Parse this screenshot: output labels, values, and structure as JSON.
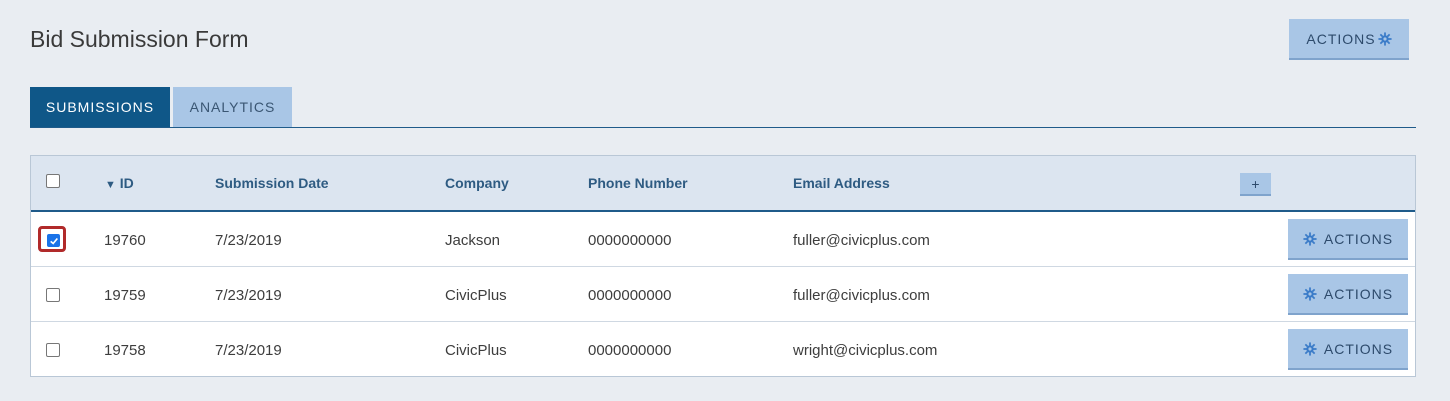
{
  "page": {
    "title": "Bid Submission Form",
    "actions_label": "ACTIONS"
  },
  "tabs": [
    {
      "label": "SUBMISSIONS",
      "active": true
    },
    {
      "label": "ANALYTICS",
      "active": false
    }
  ],
  "table": {
    "sort_indicator": "▼",
    "columns": {
      "id": "ID",
      "submission_date": "Submission Date",
      "company": "Company",
      "phone": "Phone Number",
      "email": "Email Address"
    },
    "add_column_label": "+",
    "row_actions_label": "ACTIONS",
    "rows": [
      {
        "id": "19760",
        "date": "7/23/2019",
        "company": "Jackson",
        "phone": "0000000000",
        "email": "fuller@civicplus.com",
        "checked": true
      },
      {
        "id": "19759",
        "date": "7/23/2019",
        "company": "CivicPlus",
        "phone": "0000000000",
        "email": "fuller@civicplus.com",
        "checked": false
      },
      {
        "id": "19758",
        "date": "7/23/2019",
        "company": "CivicPlus",
        "phone": "0000000000",
        "email": "wright@civicplus.com",
        "checked": false
      }
    ]
  },
  "icons": {
    "gear": "gear-icon",
    "sort": "sort-down-icon"
  },
  "colors": {
    "primary": "#0f5788",
    "button_bg": "#a9c6e6",
    "header_bg": "#dce5f0",
    "focus_outline": "#b12a2a",
    "checkbox_checked": "#1a73e8"
  }
}
